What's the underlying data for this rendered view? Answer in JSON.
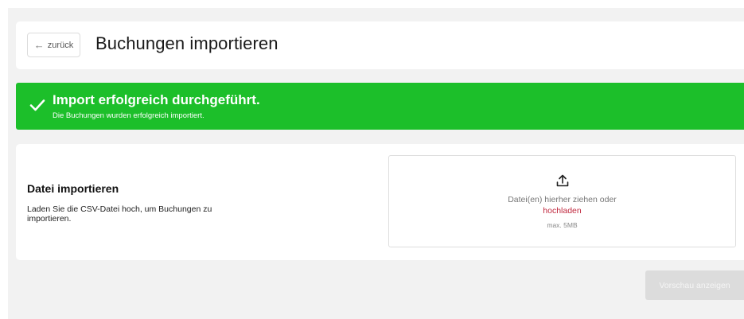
{
  "header": {
    "back_label": "zurück",
    "back_icon": "arrow-left-icon",
    "title": "Buchungen importieren"
  },
  "success": {
    "icon": "check-icon",
    "title": "Import erfolgreich durchgeführt.",
    "message": "Die Buchungen wurden erfolgreich importiert.",
    "color": "#1cbf2a"
  },
  "import": {
    "heading": "Datei importieren",
    "description": "Laden Sie die CSV-Datei hoch, um Buchungen zu importieren.",
    "dropzone": {
      "icon": "upload-icon",
      "text": "Datei(en) hierher ziehen oder",
      "link_label": "hochladen",
      "max_size": "max. 5MB",
      "link_color": "#c0283e"
    }
  },
  "actions": {
    "preview_label": "Vorschau anzeigen",
    "preview_disabled": true
  }
}
